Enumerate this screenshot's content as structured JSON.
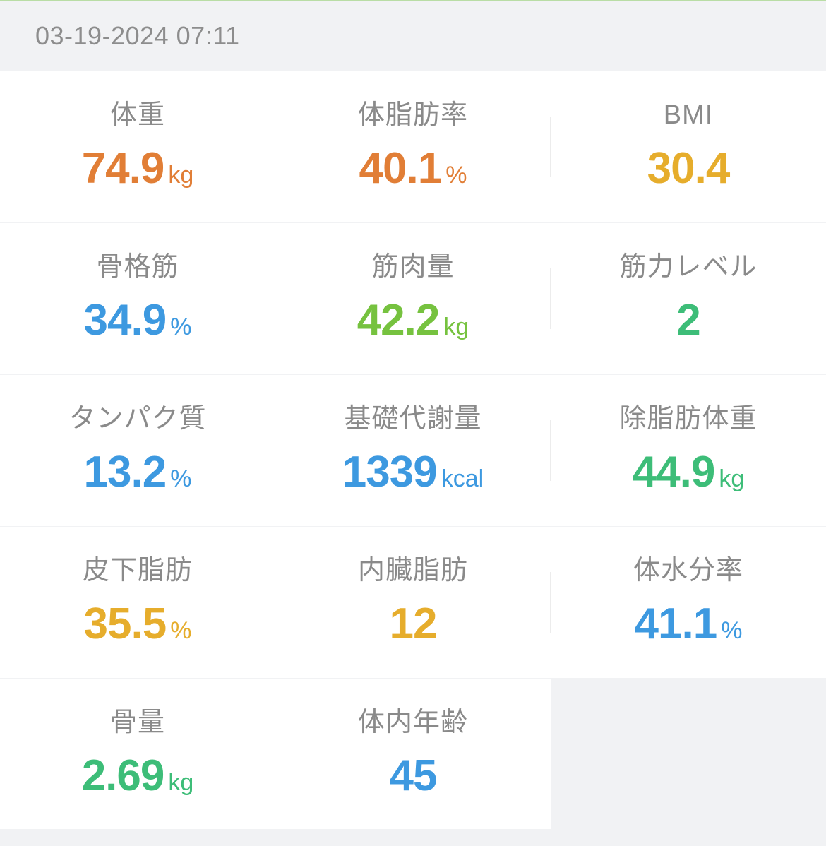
{
  "header": {
    "timestamp": "03-19-2024 07:11"
  },
  "colors": {
    "orange": "#e17e36",
    "yellow": "#e6ad2c",
    "blue": "#3d99e0",
    "lime": "#76c23f",
    "green": "#3dbd78",
    "label_gray": "#8a8a8a",
    "background": "#f1f2f4"
  },
  "metrics": [
    {
      "label": "体重",
      "value": "74.9",
      "unit": "kg",
      "color": "orange"
    },
    {
      "label": "体脂肪率",
      "value": "40.1",
      "unit": "%",
      "color": "orange"
    },
    {
      "label": "BMI",
      "value": "30.4",
      "unit": "",
      "color": "yellow"
    },
    {
      "label": "骨格筋",
      "value": "34.9",
      "unit": "%",
      "color": "blue"
    },
    {
      "label": "筋肉量",
      "value": "42.2",
      "unit": "kg",
      "color": "lime"
    },
    {
      "label": "筋力レベル",
      "value": "2",
      "unit": "",
      "color": "green"
    },
    {
      "label": "タンパク質",
      "value": "13.2",
      "unit": "%",
      "color": "blue"
    },
    {
      "label": "基礎代謝量",
      "value": "1339",
      "unit": "kcal",
      "color": "blue"
    },
    {
      "label": "除脂肪体重",
      "value": "44.9",
      "unit": "kg",
      "color": "green"
    },
    {
      "label": "皮下脂肪",
      "value": "35.5",
      "unit": "%",
      "color": "yellow"
    },
    {
      "label": "内臓脂肪",
      "value": "12",
      "unit": "",
      "color": "yellow"
    },
    {
      "label": "体水分率",
      "value": "41.1",
      "unit": "%",
      "color": "blue"
    },
    {
      "label": "骨量",
      "value": "2.69",
      "unit": "kg",
      "color": "green"
    },
    {
      "label": "体内年齢",
      "value": "45",
      "unit": "",
      "color": "blue"
    }
  ]
}
